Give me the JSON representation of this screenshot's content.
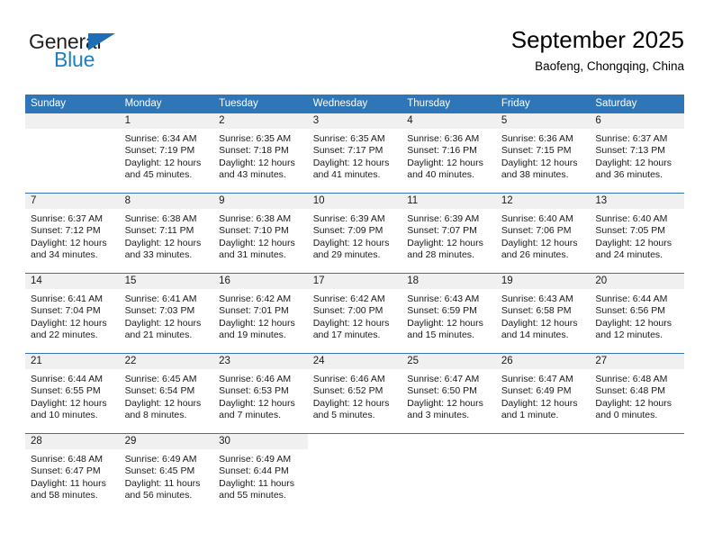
{
  "brand": {
    "line1": "General",
    "line2": "Blue",
    "triangle_color": "#1f6db4",
    "blue_text_color": "#1a7fc1"
  },
  "header": {
    "title": "September 2025",
    "subtitle": "Baofeng, Chongqing, China"
  },
  "theme": {
    "header_blue": "#2e76b8",
    "daynum_band": "#f0f0f0",
    "text": "#1a1a1a"
  },
  "weekday_headers": [
    "Sunday",
    "Monday",
    "Tuesday",
    "Wednesday",
    "Thursday",
    "Friday",
    "Saturday"
  ],
  "weeks": [
    [
      {
        "day": "",
        "lines": []
      },
      {
        "day": "1",
        "lines": [
          "Sunrise: 6:34 AM",
          "Sunset: 7:19 PM",
          "Daylight: 12 hours",
          "and 45 minutes."
        ]
      },
      {
        "day": "2",
        "lines": [
          "Sunrise: 6:35 AM",
          "Sunset: 7:18 PM",
          "Daylight: 12 hours",
          "and 43 minutes."
        ]
      },
      {
        "day": "3",
        "lines": [
          "Sunrise: 6:35 AM",
          "Sunset: 7:17 PM",
          "Daylight: 12 hours",
          "and 41 minutes."
        ]
      },
      {
        "day": "4",
        "lines": [
          "Sunrise: 6:36 AM",
          "Sunset: 7:16 PM",
          "Daylight: 12 hours",
          "and 40 minutes."
        ]
      },
      {
        "day": "5",
        "lines": [
          "Sunrise: 6:36 AM",
          "Sunset: 7:15 PM",
          "Daylight: 12 hours",
          "and 38 minutes."
        ]
      },
      {
        "day": "6",
        "lines": [
          "Sunrise: 6:37 AM",
          "Sunset: 7:13 PM",
          "Daylight: 12 hours",
          "and 36 minutes."
        ]
      }
    ],
    [
      {
        "day": "7",
        "lines": [
          "Sunrise: 6:37 AM",
          "Sunset: 7:12 PM",
          "Daylight: 12 hours",
          "and 34 minutes."
        ]
      },
      {
        "day": "8",
        "lines": [
          "Sunrise: 6:38 AM",
          "Sunset: 7:11 PM",
          "Daylight: 12 hours",
          "and 33 minutes."
        ]
      },
      {
        "day": "9",
        "lines": [
          "Sunrise: 6:38 AM",
          "Sunset: 7:10 PM",
          "Daylight: 12 hours",
          "and 31 minutes."
        ]
      },
      {
        "day": "10",
        "lines": [
          "Sunrise: 6:39 AM",
          "Sunset: 7:09 PM",
          "Daylight: 12 hours",
          "and 29 minutes."
        ]
      },
      {
        "day": "11",
        "lines": [
          "Sunrise: 6:39 AM",
          "Sunset: 7:07 PM",
          "Daylight: 12 hours",
          "and 28 minutes."
        ]
      },
      {
        "day": "12",
        "lines": [
          "Sunrise: 6:40 AM",
          "Sunset: 7:06 PM",
          "Daylight: 12 hours",
          "and 26 minutes."
        ]
      },
      {
        "day": "13",
        "lines": [
          "Sunrise: 6:40 AM",
          "Sunset: 7:05 PM",
          "Daylight: 12 hours",
          "and 24 minutes."
        ]
      }
    ],
    [
      {
        "day": "14",
        "lines": [
          "Sunrise: 6:41 AM",
          "Sunset: 7:04 PM",
          "Daylight: 12 hours",
          "and 22 minutes."
        ]
      },
      {
        "day": "15",
        "lines": [
          "Sunrise: 6:41 AM",
          "Sunset: 7:03 PM",
          "Daylight: 12 hours",
          "and 21 minutes."
        ]
      },
      {
        "day": "16",
        "lines": [
          "Sunrise: 6:42 AM",
          "Sunset: 7:01 PM",
          "Daylight: 12 hours",
          "and 19 minutes."
        ]
      },
      {
        "day": "17",
        "lines": [
          "Sunrise: 6:42 AM",
          "Sunset: 7:00 PM",
          "Daylight: 12 hours",
          "and 17 minutes."
        ]
      },
      {
        "day": "18",
        "lines": [
          "Sunrise: 6:43 AM",
          "Sunset: 6:59 PM",
          "Daylight: 12 hours",
          "and 15 minutes."
        ]
      },
      {
        "day": "19",
        "lines": [
          "Sunrise: 6:43 AM",
          "Sunset: 6:58 PM",
          "Daylight: 12 hours",
          "and 14 minutes."
        ]
      },
      {
        "day": "20",
        "lines": [
          "Sunrise: 6:44 AM",
          "Sunset: 6:56 PM",
          "Daylight: 12 hours",
          "and 12 minutes."
        ]
      }
    ],
    [
      {
        "day": "21",
        "lines": [
          "Sunrise: 6:44 AM",
          "Sunset: 6:55 PM",
          "Daylight: 12 hours",
          "and 10 minutes."
        ]
      },
      {
        "day": "22",
        "lines": [
          "Sunrise: 6:45 AM",
          "Sunset: 6:54 PM",
          "Daylight: 12 hours",
          "and 8 minutes."
        ]
      },
      {
        "day": "23",
        "lines": [
          "Sunrise: 6:46 AM",
          "Sunset: 6:53 PM",
          "Daylight: 12 hours",
          "and 7 minutes."
        ]
      },
      {
        "day": "24",
        "lines": [
          "Sunrise: 6:46 AM",
          "Sunset: 6:52 PM",
          "Daylight: 12 hours",
          "and 5 minutes."
        ]
      },
      {
        "day": "25",
        "lines": [
          "Sunrise: 6:47 AM",
          "Sunset: 6:50 PM",
          "Daylight: 12 hours",
          "and 3 minutes."
        ]
      },
      {
        "day": "26",
        "lines": [
          "Sunrise: 6:47 AM",
          "Sunset: 6:49 PM",
          "Daylight: 12 hours",
          "and 1 minute."
        ]
      },
      {
        "day": "27",
        "lines": [
          "Sunrise: 6:48 AM",
          "Sunset: 6:48 PM",
          "Daylight: 12 hours",
          "and 0 minutes."
        ]
      }
    ],
    [
      {
        "day": "28",
        "lines": [
          "Sunrise: 6:48 AM",
          "Sunset: 6:47 PM",
          "Daylight: 11 hours",
          "and 58 minutes."
        ]
      },
      {
        "day": "29",
        "lines": [
          "Sunrise: 6:49 AM",
          "Sunset: 6:45 PM",
          "Daylight: 11 hours",
          "and 56 minutes."
        ]
      },
      {
        "day": "30",
        "lines": [
          "Sunrise: 6:49 AM",
          "Sunset: 6:44 PM",
          "Daylight: 11 hours",
          "and 55 minutes."
        ]
      },
      {
        "day": "",
        "lines": []
      },
      {
        "day": "",
        "lines": []
      },
      {
        "day": "",
        "lines": []
      },
      {
        "day": "",
        "lines": []
      }
    ]
  ]
}
